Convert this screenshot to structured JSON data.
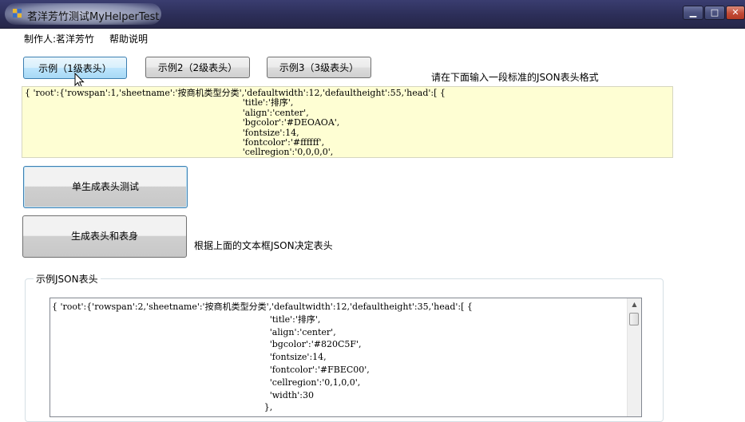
{
  "window": {
    "title": "茗洋芳竹测试MyHelperTest",
    "min_glyph": "▁",
    "max_glyph": "□",
    "close_glyph": "✕"
  },
  "menu": {
    "items": [
      {
        "label": "制作人:茗洋芳竹"
      },
      {
        "label": "帮助说明"
      }
    ]
  },
  "example_buttons": [
    {
      "label": "示例（1级表头）"
    },
    {
      "label": "示例2（2级表头）"
    },
    {
      "label": "示例3（3级表头）"
    }
  ],
  "input_hint": "请在下面输入一段标准的JSON表头格式",
  "json_input_value": "{ 'root':{'rowspan':1,'sheetname':'按商机类型分类','defaultwidth':12,'defaultheight':55,'head':[ {\n                                                                              'title':'排序',\n                                                                              'align':'center',\n                                                                              'bgcolor':'#DEOAOA',\n                                                                              'fontsize':14,\n                                                                              'fontcolor':'#ffffff',\n                                                                              'cellregion':'0,0,0,0',",
  "buttons": {
    "single_header_label": "单生成表头测试",
    "header_body_label": "生成表头和表身"
  },
  "decide_hint": "根据上面的文本框JSON决定表头",
  "example_group": {
    "label": "示例JSON表头",
    "json_value": "{ 'root':{'rowspan':2,'sheetname':'按商机类型分类','defaultwidth':12,'defaultheight':35,'head':[ {\n                                                                              'title':'排序',\n                                                                              'align':'center',\n                                                                              'bgcolor':'#820C5F',\n                                                                              'fontsize':14,\n                                                                              'fontcolor':'#FBEC00',\n                                                                              'cellregion':'0,1,0,0',\n                                                                              'width':30\n                                                                            },"
  },
  "colors": {
    "titlebar": "#2c2e58",
    "input_background": "#fefed3",
    "focus_border": "#3c7fb1"
  }
}
